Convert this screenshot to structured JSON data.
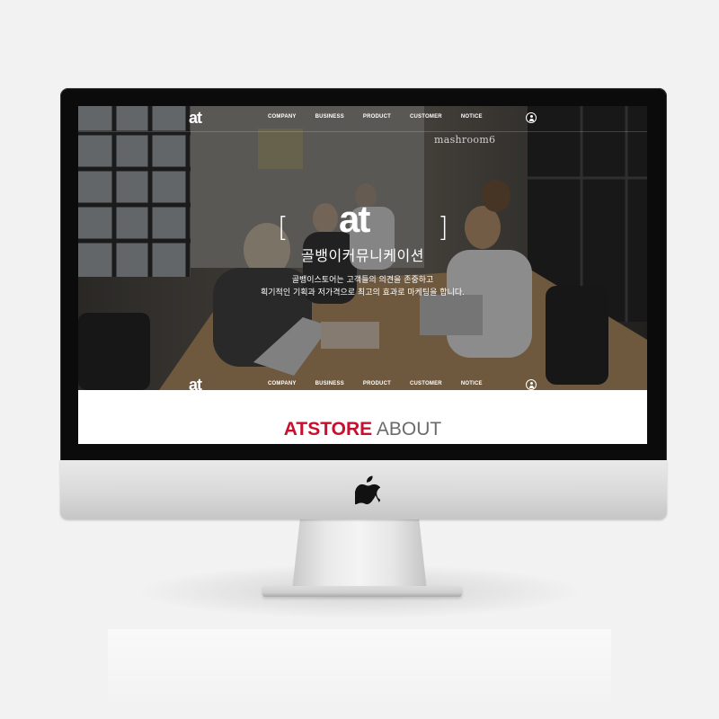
{
  "site": {
    "logo_text": "at",
    "nav_items": [
      "COMPANY",
      "BUSINESS",
      "PRODUCT",
      "CUSTOMER",
      "NOTICE"
    ]
  },
  "hero": {
    "logo_text": "at",
    "bracket_left": "[",
    "bracket_right": "]",
    "title": "골뱅이커뮤니케이션",
    "description_line1": "골뱅이스토어는 고객들의 의견을 존중하고",
    "description_line2": "획기적인 기획과 저가격으로 최고의 효과로 마케팅을 합니다.",
    "wall_sign": "mashroom6"
  },
  "about": {
    "title_accent": "ATSTORE",
    "title_rest": "ABOUT"
  },
  "colors": {
    "accent": "#c8102e",
    "about_gray": "#6b6b6b",
    "bezel": "#0b0b0b",
    "background": "#f2f2f2"
  },
  "icons": {
    "user": "user-icon",
    "apple": "apple-logo-icon"
  }
}
